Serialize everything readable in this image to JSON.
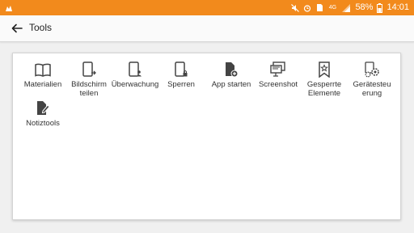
{
  "status_bar": {
    "battery": "58%",
    "time": "14:01",
    "network": "4G"
  },
  "header": {
    "title": "Tools"
  },
  "tools": [
    {
      "label": "Materialien",
      "icon": "book-icon"
    },
    {
      "label": "Bildschirm teilen",
      "icon": "tablet-share-icon"
    },
    {
      "label": "Überwachung",
      "icon": "tablet-user-icon"
    },
    {
      "label": "Sperren",
      "icon": "tablet-lock-icon"
    },
    {
      "label": "App starten",
      "icon": "file-add-icon"
    },
    {
      "label": "Screenshot",
      "icon": "screenshot-icon"
    },
    {
      "label": "Gesperrte Elemente",
      "icon": "bookmark-star-icon"
    },
    {
      "label": "Gerätesteu erung",
      "icon": "device-gear-icon"
    },
    {
      "label": "Notiztools",
      "icon": "note-edit-icon"
    }
  ],
  "colors": {
    "status_bar": "#f28a1c",
    "icon": "#444444",
    "text": "#333333"
  }
}
